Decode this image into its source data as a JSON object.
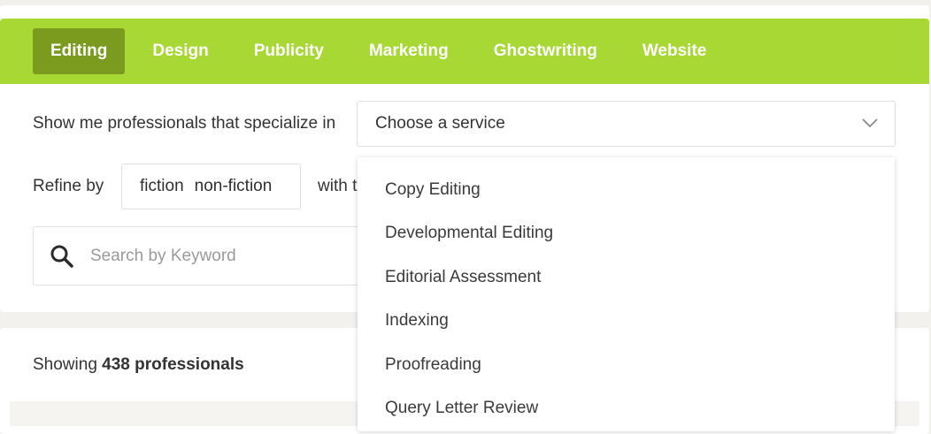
{
  "tabs": [
    {
      "label": "Editing",
      "active": true
    },
    {
      "label": "Design",
      "active": false
    },
    {
      "label": "Publicity",
      "active": false
    },
    {
      "label": "Marketing",
      "active": false
    },
    {
      "label": "Ghostwriting",
      "active": false
    },
    {
      "label": "Website",
      "active": false
    }
  ],
  "filters": {
    "specialize_label": "Show me professionals that specialize in",
    "service_select_value": "Choose a service",
    "refine_label": "Refine by",
    "genre_options": [
      "fiction",
      "non-fiction"
    ],
    "with_label": "with t"
  },
  "search": {
    "placeholder": "Search by Keyword"
  },
  "results": {
    "prefix": "Showing ",
    "count_text": "438 professionals"
  },
  "dropdown": {
    "options": [
      "Copy Editing",
      "Developmental Editing",
      "Editorial Assessment",
      "Indexing",
      "Proofreading",
      "Query Letter Review"
    ]
  },
  "colors": {
    "accent": "#a7d834",
    "active_tab": "#7a9b1e",
    "page_bg": "#f3f1ee"
  },
  "icons": {
    "search": "search-icon",
    "chevron": "chevron-down-icon"
  }
}
